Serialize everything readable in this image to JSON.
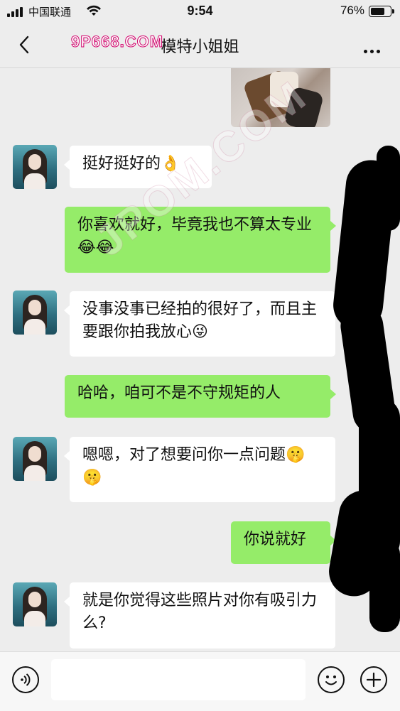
{
  "status_bar": {
    "carrier": "中国联通",
    "time": "9:54",
    "battery": "76%",
    "battery_level": 0.76
  },
  "nav": {
    "title": "模特小姐姐",
    "watermark": "9P668.COM"
  },
  "overlay_watermark": "JPOM.COM",
  "messages": [
    {
      "side": "left",
      "text": "挺好挺好的👌"
    },
    {
      "side": "right",
      "text": "你喜欢就好，毕竟我也不算太专业😂😂"
    },
    {
      "side": "left",
      "text": "没事没事已经拍的很好了，而且主要跟你拍我放心😜"
    },
    {
      "side": "right",
      "text": "哈哈，咱可不是不守规矩的人"
    },
    {
      "side": "left",
      "text": "嗯嗯，对了想要问你一点问题🤫🤫"
    },
    {
      "side": "right",
      "text": "你说就好"
    },
    {
      "side": "left",
      "text": "就是你觉得这些照片对你有吸引力么?"
    }
  ],
  "colors": {
    "background": "#ededed",
    "bubble_self": "#95ec69",
    "bubble_other": "#ffffff"
  }
}
